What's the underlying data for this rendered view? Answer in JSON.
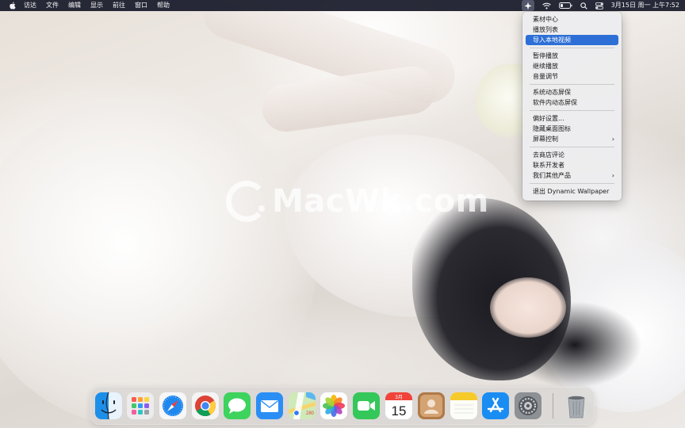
{
  "menubar": {
    "menus": [
      "访达",
      "文件",
      "编辑",
      "显示",
      "前往",
      "窗口",
      "帮助"
    ],
    "clock": "3月15日 周一 上午7:52"
  },
  "dropdown": {
    "groups": [
      [
        "素材中心",
        "播放列表",
        "导入本地视频"
      ],
      [
        "暂停播放",
        "继续播放",
        "音量调节"
      ],
      [
        "系统动态屏保",
        "软件内动态屏保"
      ],
      [
        "偏好设置...",
        "隐藏桌面图标",
        "屏幕控制"
      ],
      [
        "去商店评论",
        "联系开发者",
        "我们其他产品"
      ],
      [
        "退出 Dynamic Wallpaper"
      ]
    ],
    "highlighted": "导入本地视频",
    "has_submenu": [
      "屏幕控制",
      "我们其他产品"
    ]
  },
  "wallpaper": {
    "watermark": "MacWk.com"
  },
  "dock": {
    "apps": [
      "finder-icon",
      "launchpad-icon",
      "safari-icon",
      "chrome-icon",
      "messages-icon",
      "mail-icon",
      "maps-icon",
      "photos-icon",
      "facetime-icon",
      "calendar-icon",
      "contacts-icon",
      "notes-icon",
      "app-store-icon",
      "system-preferences-icon",
      "trash-icon"
    ],
    "calendar_month": "3月",
    "calendar_day": "15"
  },
  "colors": {
    "menubar": "#161828",
    "highlight": "#2d6fd6",
    "menu_bg": "#ececee"
  }
}
